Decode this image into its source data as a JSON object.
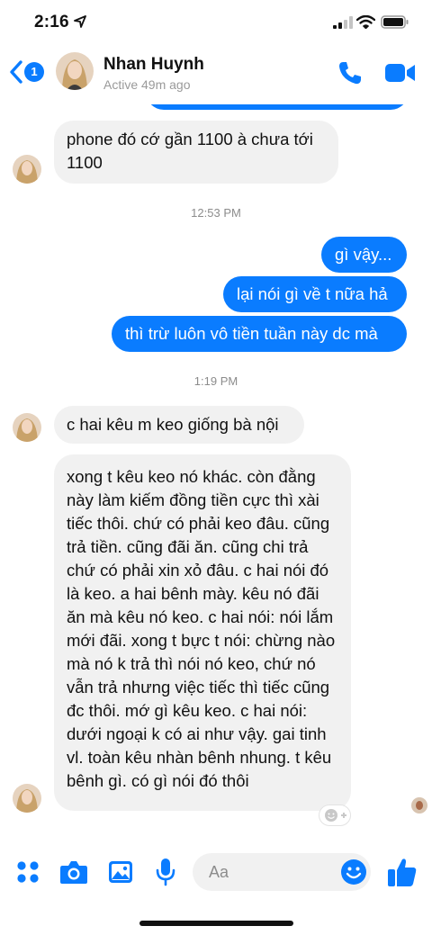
{
  "status_bar": {
    "time": "2:16"
  },
  "header": {
    "back_badge": "1",
    "contact_name": "Nhan Huynh",
    "contact_status": "Active 49m ago"
  },
  "messages": [
    {
      "from": "them",
      "text": "phone đó cớ gần 1100 à chưa tới 1100"
    },
    {
      "timestamp": "12:53 PM"
    },
    {
      "from": "me",
      "text": "gì vậy..."
    },
    {
      "from": "me",
      "text": "lại nói gì về t nữa hả"
    },
    {
      "from": "me",
      "text": "thì trừ luôn vô tiền tuần này dc mà"
    },
    {
      "timestamp": "1:19 PM"
    },
    {
      "from": "them",
      "text": "c hai kêu m keo giống bà nội"
    },
    {
      "from": "them",
      "text": "xong t kêu keo nó khác. còn đằng này làm kiếm đồng tiền cực thì xài tiếc thôi. chứ có phải keo đâu. cũng trả tiền. cũng đãi ăn. cũng chi trả chứ có phải xin xỏ đâu. c hai nói đó là keo. a hai bênh mày. kêu nó đãi ăn mà kêu nó keo. c hai nói: nói lắm mới đãi. xong t bực t nói: chừng nào mà nó k trả thì nói nó keo, chứ nó vẫn trả nhưng việc tiếc thì tiếc cũng đc thôi. mớ gì kêu keo. c hai nói: dưới ngoại k có ai như vậy. gai tinh vl. toàn kêu nhàn bênh nhung. t kêu bênh gì. có gì nói đó thôi"
    }
  ],
  "composer": {
    "placeholder": "Aa"
  },
  "colors": {
    "accent": "#0a7cff",
    "incoming_bubble": "#f1f1f1",
    "timestamp": "#8c8c8c"
  },
  "icons": [
    "location-arrow-icon",
    "signal-icon",
    "wifi-icon",
    "battery-icon",
    "back-chevron-icon",
    "phone-icon",
    "video-camera-icon",
    "apps-grid-icon",
    "camera-icon",
    "gallery-icon",
    "microphone-icon",
    "emoji-icon",
    "thumbs-up-icon",
    "add-reaction-icon"
  ]
}
